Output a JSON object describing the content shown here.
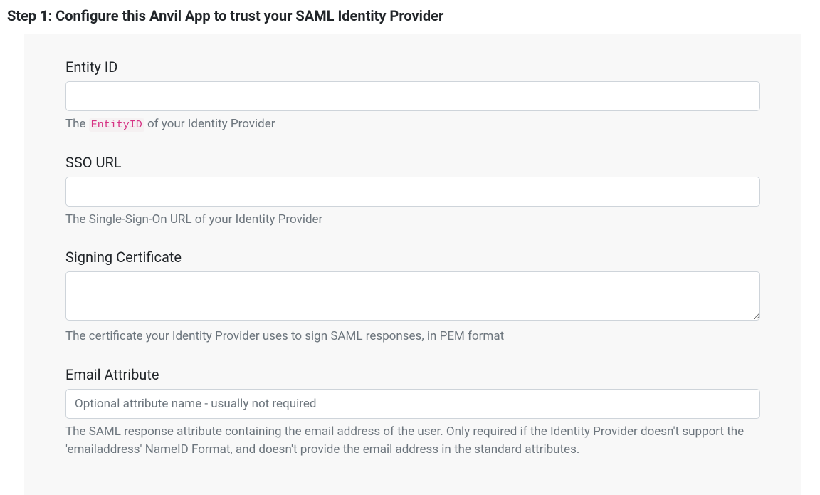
{
  "title": "Step 1: Configure this Anvil App to trust your SAML Identity Provider",
  "fields": {
    "entity_id": {
      "label": "Entity ID",
      "value": "",
      "help_prefix": "The ",
      "help_code": "EntityID",
      "help_suffix": " of your Identity Provider"
    },
    "sso_url": {
      "label": "SSO URL",
      "value": "",
      "help": "The Single-Sign-On URL of your Identity Provider"
    },
    "signing_cert": {
      "label": "Signing Certificate",
      "value": "",
      "help": "The certificate your Identity Provider uses to sign SAML responses, in PEM format"
    },
    "email_attr": {
      "label": "Email Attribute",
      "value": "",
      "placeholder": "Optional attribute name - usually not required",
      "help": "The SAML response attribute containing the email address of the user. Only required if the Identity Provider doesn't support the 'emailaddress' NameID Format, and doesn't provide the email address in the standard attributes."
    }
  }
}
